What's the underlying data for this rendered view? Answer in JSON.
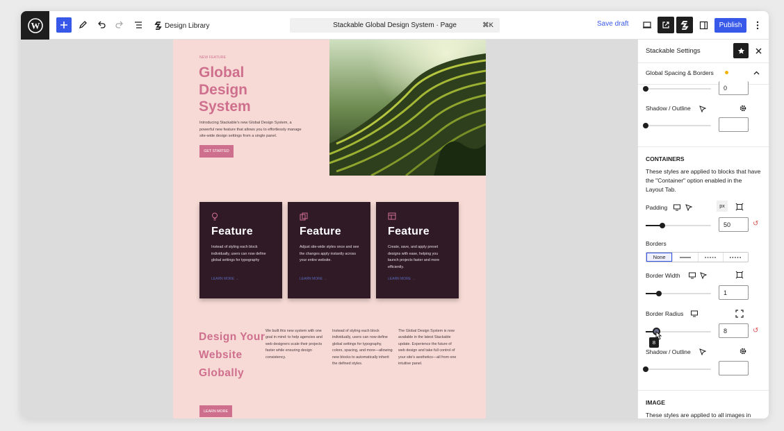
{
  "toolbar": {
    "design_library_label": "Design Library",
    "document_title": "Stackable Global Design System · Page",
    "shortcut": "⌘K",
    "save_draft_label": "Save draft",
    "publish_label": "Publish"
  },
  "page": {
    "eyebrow": "NEW FEATURE",
    "hero_title": "Global Design System",
    "hero_description": "Introducing Stackable's new Global Design System, a powerful new feature that allows you to effortlessly manage site-wide design settings from a single panel.",
    "hero_cta": "GET STARTED",
    "cards": [
      {
        "title": "Feature",
        "description": "Instead of styling each block individually, users can now define global settings for typography",
        "link": "LEARN MORE →"
      },
      {
        "title": "Feature",
        "description": "Adjust site-wide styles once and see the changes apply instantly across your entire website.",
        "link": "LEARN MORE →"
      },
      {
        "title": "Feature",
        "description": "Create, save, and apply preset designs with ease, helping you launch projects faster and more efficiently.",
        "link": "LEARN MORE →"
      }
    ],
    "design_title": "Design Your Website Globally",
    "columns": [
      "We built this new system with one goal in mind: to help agencies and web designers scale their projects faster while ensuring design consistency.",
      "Instead of styling each block individually, users can now define global settings for typography, colors, spacing, and more—allowing new blocks to automatically inherit the defined styles.",
      "The Global Design System is now available in the latest Stackable update. Experience the future of web design and take full control of your site's aesthetics—all from one intuitive panel."
    ],
    "bottom_cta": "LEARN MORE"
  },
  "sidebar": {
    "title": "Stackable Settings",
    "section_title": "Global Spacing & Borders",
    "top_value": "0",
    "shadow_outline_label": "Shadow / Outline",
    "shadow_value_top": "",
    "containers_heading": "CONTAINERS",
    "containers_desc": "These styles are applied to blocks that have the \"Container\" option enabled in the Layout Tab.",
    "padding_label": "Padding",
    "padding_unit": "px",
    "padding_value": "50",
    "borders_label": "Borders",
    "border_none_label": "None",
    "border_width_label": "Border Width",
    "border_width_value": "1",
    "border_radius_label": "Border Radius",
    "border_radius_value": "8",
    "tooltip_value": "8",
    "shadow_outline_label_2": "Shadow / Outline",
    "shadow_value_bottom": "",
    "image_heading": "IMAGE",
    "image_desc": "These styles are applied to all images in"
  },
  "colors": {
    "accent": "#3858e9",
    "brand_pink": "#cf6f8e",
    "page_bg": "#f7dad5",
    "card_bg": "#301a26"
  }
}
